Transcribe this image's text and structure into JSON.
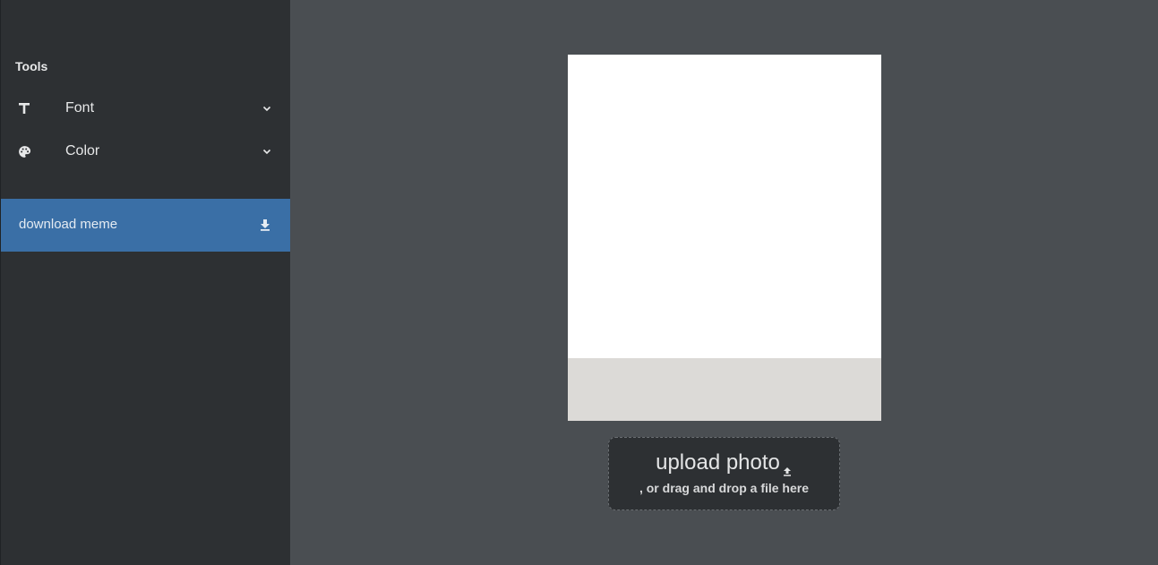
{
  "colors": {
    "sidebar_bg": "#2d3033",
    "main_bg": "#4a4e52",
    "accent": "#3a6fa6"
  },
  "sidebar": {
    "heading": "Tools",
    "tools": [
      {
        "label": "Font",
        "icon": "text-icon"
      },
      {
        "label": "Color",
        "icon": "palette-icon"
      }
    ],
    "download": {
      "label": "download meme",
      "icon": "download-icon"
    }
  },
  "upload": {
    "title": "upload photo",
    "subtitle": ", or drag and drop a file here",
    "icon": "upload-icon"
  }
}
